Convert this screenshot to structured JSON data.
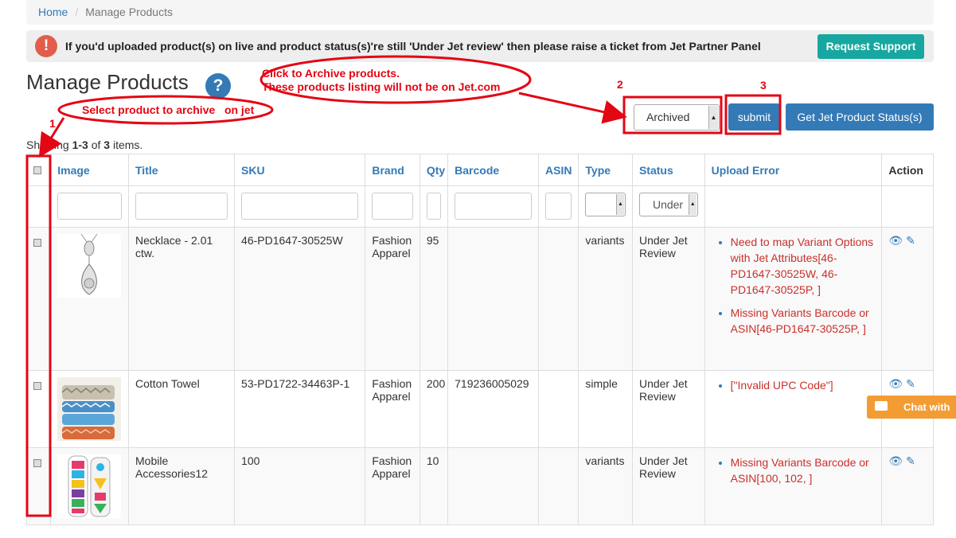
{
  "breadcrumb": {
    "home": "Home",
    "current": "Manage Products"
  },
  "alert": {
    "icon": "!",
    "message": "If you'd uploaded product(s) on live and product status(s)'re still 'Under Jet review' then please raise a ticket from Jet Partner Panel",
    "button": "Request Support"
  },
  "page": {
    "title": "Manage Products",
    "help_icon": "?"
  },
  "toolbar": {
    "status_value": "Archived",
    "submit_label": "submit",
    "status_button": "Get Jet Product Status(s)"
  },
  "summary": {
    "prefix": "Showing ",
    "range": "1-3",
    "mid": " of ",
    "total": "3",
    "suffix": " items."
  },
  "table": {
    "headers": {
      "image": "Image",
      "title": "Title",
      "sku": "SKU",
      "brand": "Brand",
      "qty": "Qty",
      "barcode": "Barcode",
      "asin": "ASIN",
      "type": "Type",
      "status": "Status",
      "upload_error": "Upload Error",
      "action": "Action"
    },
    "status_filter_value": "Under Jet Review",
    "rows": [
      {
        "title": "Necklace - 2.01 ctw.",
        "sku": "46-PD1647-30525W",
        "brand": "Fashion Apparel",
        "qty": "95",
        "barcode": "",
        "asin": "",
        "type": "variants",
        "status": "Under Jet Review",
        "errors": [
          "Need to map Variant Options with Jet Attributes[46-PD1647-30525W, 46-PD1647-30525P, ]",
          "Missing Variants Barcode or ASIN[46-PD1647-30525P, ]"
        ]
      },
      {
        "title": "Cotton Towel",
        "sku": "53-PD1722-34463P-1",
        "brand": "Fashion Apparel",
        "qty": "200",
        "barcode": "719236005029",
        "asin": "",
        "type": "simple",
        "status": "Under Jet Review",
        "errors": [
          "[\"Invalid UPC Code\"]"
        ]
      },
      {
        "title": "Mobile Accessories12",
        "sku": "100",
        "brand": "Fashion Apparel",
        "qty": "10",
        "barcode": "",
        "asin": "",
        "type": "variants",
        "status": "Under Jet Review",
        "errors": [
          "Missing Variants Barcode or ASIN[100, 102, ]"
        ]
      }
    ]
  },
  "chat": {
    "label": "Chat with"
  },
  "annotations": {
    "select_hint": "Select product to archive   on jet",
    "archive_hint_line1": "Click to Archive products.",
    "archive_hint_line2": "These products listing will not be on Jet.com",
    "step1": "1",
    "step2": "2",
    "step3": "3"
  },
  "colors": {
    "primary": "#337ab7",
    "teal": "#17a7a0",
    "alert_red": "#e25d4c",
    "error_text": "#c9302c",
    "annotation": "#e30613",
    "chat": "#f39c34"
  }
}
